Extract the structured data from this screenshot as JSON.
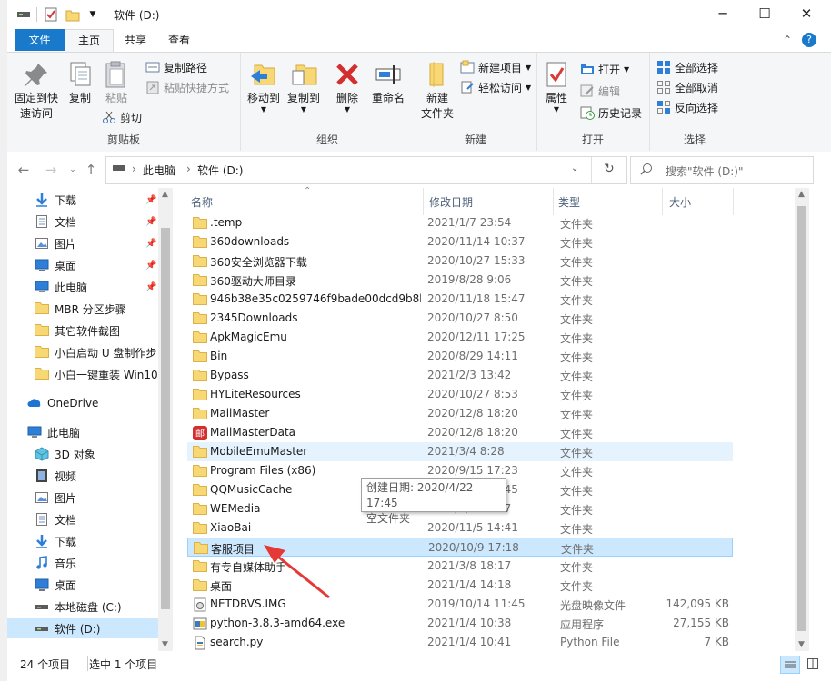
{
  "window": {
    "title": "软件 (D:)",
    "minimize": "─",
    "maximize": "☐",
    "close": "✕"
  },
  "ribbon_tabs": {
    "file": "文件",
    "home": "主页",
    "share": "共享",
    "view": "查看",
    "collapse": "⌃",
    "help": "?"
  },
  "ribbon": {
    "clipboard": {
      "label": "剪贴板",
      "pin_line1": "固定到快",
      "pin_line2": "速访问",
      "copy": "复制",
      "paste": "粘贴",
      "copy_path": "复制路径",
      "paste_shortcut": "粘贴快捷方式",
      "cut": "剪切"
    },
    "organize": {
      "label": "组织",
      "move_to": "移动到",
      "copy_to": "复制到",
      "delete": "删除",
      "rename": "重命名"
    },
    "new": {
      "label": "新建",
      "new_folder_line1": "新建",
      "new_folder_line2": "文件夹",
      "new_item": "新建项目",
      "easy_access": "轻松访问"
    },
    "open": {
      "label": "打开",
      "properties": "属性",
      "open": "打开",
      "edit": "编辑",
      "history": "历史记录"
    },
    "select": {
      "label": "选择",
      "select_all": "全部选择",
      "select_none": "全部取消",
      "invert": "反向选择"
    }
  },
  "address": {
    "segments": [
      "此电脑",
      "软件 (D:)"
    ],
    "search_placeholder": "搜索\"软件 (D:)\""
  },
  "nav_pane": {
    "quick_access": [
      {
        "label": "下载",
        "icon": "download-icon"
      },
      {
        "label": "文档",
        "icon": "document-icon"
      },
      {
        "label": "图片",
        "icon": "pictures-icon"
      },
      {
        "label": "桌面",
        "icon": "desktop-icon"
      },
      {
        "label": "此电脑",
        "icon": "computer-icon"
      },
      {
        "label": "MBR 分区步骤",
        "icon": "folder-icon"
      },
      {
        "label": "其它软件截图",
        "icon": "folder-icon"
      },
      {
        "label": "小白启动 U 盘制作步",
        "icon": "folder-icon"
      },
      {
        "label": "小白一键重装 Win10",
        "icon": "folder-icon"
      }
    ],
    "onedrive": "OneDrive",
    "this_pc": "此电脑",
    "pc_items": [
      {
        "label": "3D 对象",
        "icon": "3d-objects-icon"
      },
      {
        "label": "视频",
        "icon": "video-icon"
      },
      {
        "label": "图片",
        "icon": "pictures-icon"
      },
      {
        "label": "文档",
        "icon": "document-icon"
      },
      {
        "label": "下载",
        "icon": "download-icon"
      },
      {
        "label": "音乐",
        "icon": "music-icon"
      },
      {
        "label": "桌面",
        "icon": "desktop-icon"
      },
      {
        "label": "本地磁盘 (C:)",
        "icon": "drive-icon"
      },
      {
        "label": "软件 (D:)",
        "icon": "drive-icon"
      }
    ]
  },
  "columns": {
    "name": "名称",
    "date": "修改日期",
    "type": "类型",
    "size": "大小"
  },
  "files": [
    {
      "name": ".temp",
      "date": "2021/1/7 23:54",
      "type": "文件夹",
      "size": "",
      "icon": "folder-icon"
    },
    {
      "name": "360downloads",
      "date": "2020/11/14 10:37",
      "type": "文件夹",
      "size": "",
      "icon": "folder-icon"
    },
    {
      "name": "360安全浏览器下载",
      "date": "2020/10/27 15:33",
      "type": "文件夹",
      "size": "",
      "icon": "folder-icon"
    },
    {
      "name": "360驱动大师目录",
      "date": "2019/8/28 9:06",
      "type": "文件夹",
      "size": "",
      "icon": "folder-icon"
    },
    {
      "name": "946b38e35c0259746f9bade00dcd9b8b",
      "date": "2020/11/18 15:47",
      "type": "文件夹",
      "size": "",
      "icon": "folder-icon"
    },
    {
      "name": "2345Downloads",
      "date": "2020/10/27 8:50",
      "type": "文件夹",
      "size": "",
      "icon": "folder-icon"
    },
    {
      "name": "ApkMagicEmu",
      "date": "2020/12/11 17:25",
      "type": "文件夹",
      "size": "",
      "icon": "folder-icon"
    },
    {
      "name": "Bin",
      "date": "2020/8/29 14:11",
      "type": "文件夹",
      "size": "",
      "icon": "folder-icon"
    },
    {
      "name": "Bypass",
      "date": "2021/2/3 13:42",
      "type": "文件夹",
      "size": "",
      "icon": "folder-icon"
    },
    {
      "name": "HYLiteResources",
      "date": "2020/10/27 8:53",
      "type": "文件夹",
      "size": "",
      "icon": "folder-icon"
    },
    {
      "name": "MailMaster",
      "date": "2020/12/8 18:20",
      "type": "文件夹",
      "size": "",
      "icon": "folder-icon"
    },
    {
      "name": "MailMasterData",
      "date": "2020/12/8 18:20",
      "type": "文件夹",
      "size": "",
      "icon": "mailmaster-icon"
    },
    {
      "name": "MobileEmuMaster",
      "date": "2021/3/4 8:28",
      "type": "文件夹",
      "size": "",
      "icon": "folder-icon"
    },
    {
      "name": "Program Files (x86)",
      "date": "2020/9/15 17:23",
      "type": "文件夹",
      "size": "",
      "icon": "folder-icon"
    },
    {
      "name": "QQMusicCache",
      "date": "2021/4/22 17:45",
      "type": "文件夹",
      "size": "",
      "icon": "folder-icon"
    },
    {
      "name": "WEMedia",
      "date": "2020/8/12 9:17",
      "type": "文件夹",
      "size": "",
      "icon": "folder-icon"
    },
    {
      "name": "XiaoBai",
      "date": "2020/11/5 14:41",
      "type": "文件夹",
      "size": "",
      "icon": "folder-icon"
    },
    {
      "name": "客服项目",
      "date": "2020/10/9 17:18",
      "type": "文件夹",
      "size": "",
      "icon": "folder-icon"
    },
    {
      "name": "有专自媒体助手",
      "date": "2021/3/8 18:17",
      "type": "文件夹",
      "size": "",
      "icon": "folder-icon"
    },
    {
      "name": "桌面",
      "date": "2021/1/4 14:18",
      "type": "文件夹",
      "size": "",
      "icon": "folder-icon"
    },
    {
      "name": "NETDRVS.IMG",
      "date": "2019/10/14 11:45",
      "type": "光盘映像文件",
      "size": "142,095 KB",
      "icon": "disc-image-icon"
    },
    {
      "name": "python-3.8.3-amd64.exe",
      "date": "2021/1/4 10:38",
      "type": "应用程序",
      "size": "27,155 KB",
      "icon": "installer-icon"
    },
    {
      "name": "search.py",
      "date": "2021/1/4 10:41",
      "type": "Python File",
      "size": "7 KB",
      "icon": "python-file-icon"
    }
  ],
  "tooltip": {
    "line1": "创建日期: 2020/4/22 17:45",
    "line2": "空文件夹"
  },
  "status": {
    "count": "24 个项目",
    "selected": "选中 1 个项目"
  },
  "colors": {
    "accent": "#1979ca",
    "selection": "#cce8ff",
    "hover": "#e5f3ff",
    "folder": "#f8d775",
    "annotation_arrow": "#e53935"
  }
}
